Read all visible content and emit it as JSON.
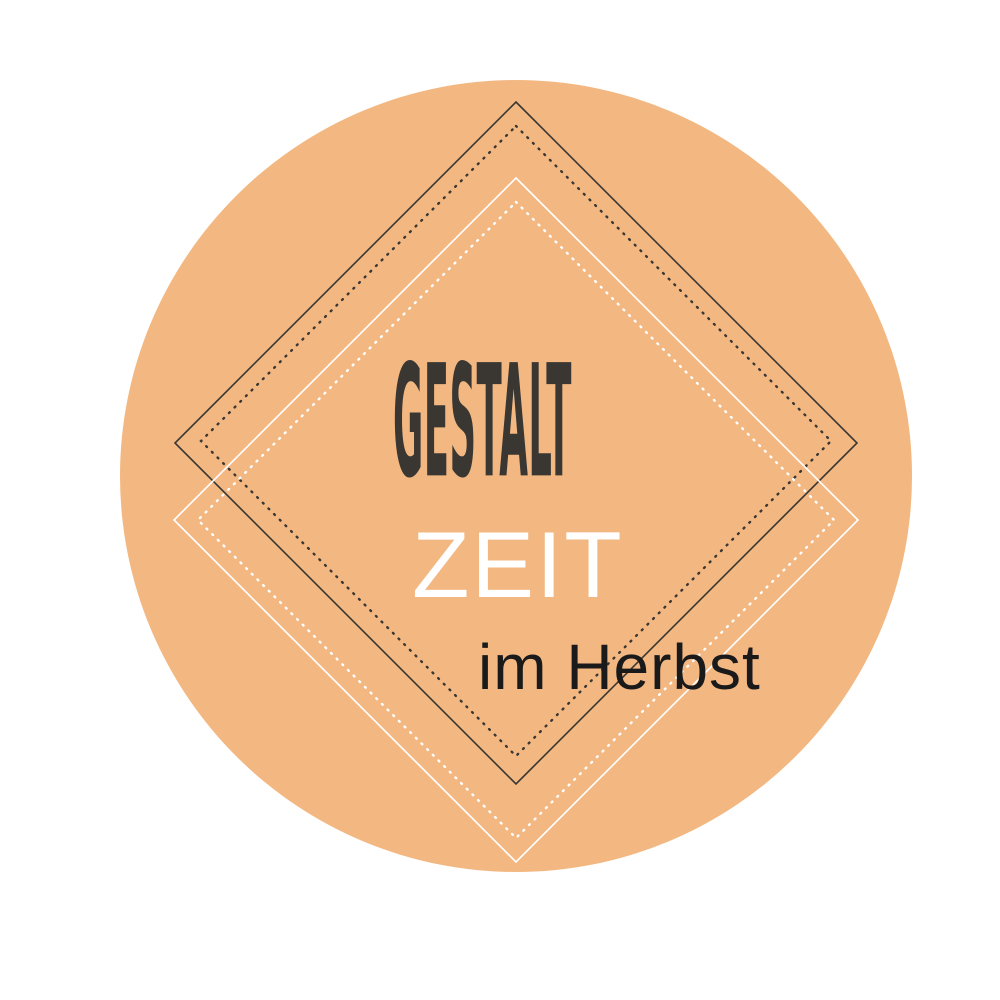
{
  "logo": {
    "title": "Gestalt",
    "subtitle": "ZEIT",
    "tagline": "im Herbst"
  },
  "colors": {
    "background": "#ffffff",
    "circle": "#f3b882",
    "dark": "#3a3733",
    "light": "#ffffff",
    "tagline": "#1a1a1a"
  }
}
